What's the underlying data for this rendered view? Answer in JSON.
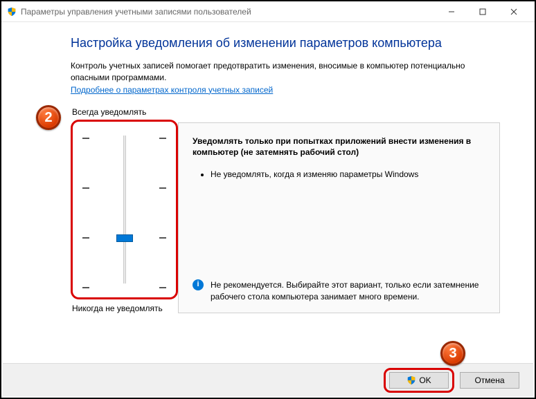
{
  "titlebar": {
    "title": "Параметры управления учетными записями пользователей"
  },
  "heading": "Настройка уведомления об изменении параметров компьютера",
  "intro": "Контроль учетных записей помогает предотвратить изменения, вносимые в компьютер потенциально опасными программами.",
  "link": "Подробнее о параметрах контроля учетных записей",
  "slider": {
    "top_label": "Всегда уведомлять",
    "bottom_label": "Никогда не уведомлять"
  },
  "description": {
    "title": "Уведомлять только при попытках приложений внести изменения в компьютер (не затемнять рабочий стол)",
    "bullet": "Не уведомлять, когда я изменяю параметры Windows",
    "warning": "Не рекомендуется. Выбирайте этот вариант, только если затемнение рабочего стола компьютера занимает много времени."
  },
  "buttons": {
    "ok": "OK",
    "cancel": "Отмена"
  },
  "annotations": {
    "badge2": "2",
    "badge3": "3"
  }
}
